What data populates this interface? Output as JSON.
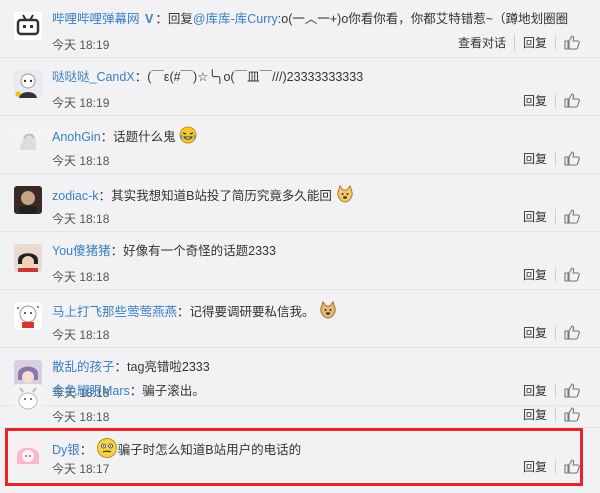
{
  "comments": [
    {
      "user": "哔哩哔哩弹幕网",
      "verified": true,
      "colon": "：",
      "prefix": "回复",
      "mention": "@库库-库Curry",
      "text": ":o(一︿一+)o你看你看，你都艾特错惹~（蹲地划圈圈",
      "time": "今天 18:19",
      "actions": [
        "查看对话",
        "回复"
      ]
    },
    {
      "user": "哒哒哒_CandX",
      "colon": "：",
      "text": "(￣ε(#￣)☆╰╮o(￣皿￣///)23333333333",
      "time": "今天 18:19",
      "actions": [
        "回复"
      ]
    },
    {
      "user": "AnohGin",
      "colon": "：",
      "text": "话题什么鬼",
      "emoji": "laugh-cry-emoji",
      "time": "今天 18:18",
      "actions": [
        "回复"
      ]
    },
    {
      "user": "zodiac-k",
      "colon": "：",
      "text": "其实我想知道B站投了简历究竟多久能回",
      "emoji": "doge-emoji",
      "time": "今天 18:18",
      "actions": [
        "回复"
      ]
    },
    {
      "user": "You傻猪猪",
      "colon": "：",
      "text": "好像有一个奇怪的话题2333",
      "time": "今天 18:18",
      "actions": [
        "回复"
      ]
    },
    {
      "user": "马上打飞那些莺莺燕燕",
      "colon": "：",
      "text": "记得要调研要私信我。",
      "emoji": "doge-emoji",
      "time": "今天 18:18",
      "actions": [
        "回复"
      ]
    },
    {
      "user": "散乱的孩子",
      "colon": "：",
      "text": "tag亮错啦2333",
      "time": "今天 18:18",
      "actions": [
        "回复"
      ]
    },
    {
      "user": "金色耀眼Mars",
      "colon": "：",
      "text": "骗子滚出。",
      "time": "今天 18:18",
      "actions": [
        "回复"
      ]
    },
    {
      "user": "Dy银",
      "colon": "：",
      "text": "骗子时怎么知道B站用户的电话的",
      "emoji": "confused-emoji",
      "time": "今天 18:17",
      "actions": [
        "回复"
      ]
    }
  ],
  "colors": {
    "link": "#3a7fc1",
    "highlight": "#e8252b"
  }
}
